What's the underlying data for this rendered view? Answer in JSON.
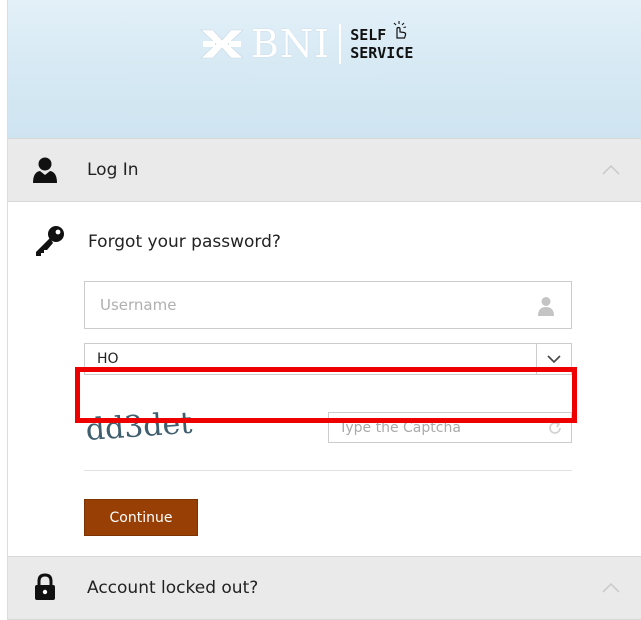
{
  "header": {
    "brand": "BNI",
    "self_line": "SELF",
    "service_line": "SERVICE"
  },
  "login_section": {
    "label": "Log In",
    "icon": "user-icon",
    "chevron": "chevron-up-icon"
  },
  "forgot_section": {
    "title": "Forgot your password?",
    "icon": "key-icon",
    "username": {
      "placeholder": "Username",
      "value": ""
    },
    "domain_select": {
      "value": "HO",
      "arrow": "chevron-down-icon"
    },
    "captcha": {
      "image_text": "dd3det",
      "placeholder": "Type the Captcha",
      "value": "",
      "refresh_icon": "refresh-icon"
    },
    "continue_label": "Continue"
  },
  "locked_section": {
    "label": "Account locked out?",
    "icon": "lock-icon",
    "chevron": "chevron-up-icon"
  },
  "colors": {
    "header_bg": "#d6e9f4",
    "continue_bg": "#973f05",
    "section_bg": "#eaeaea",
    "highlight": "#ee0000"
  }
}
